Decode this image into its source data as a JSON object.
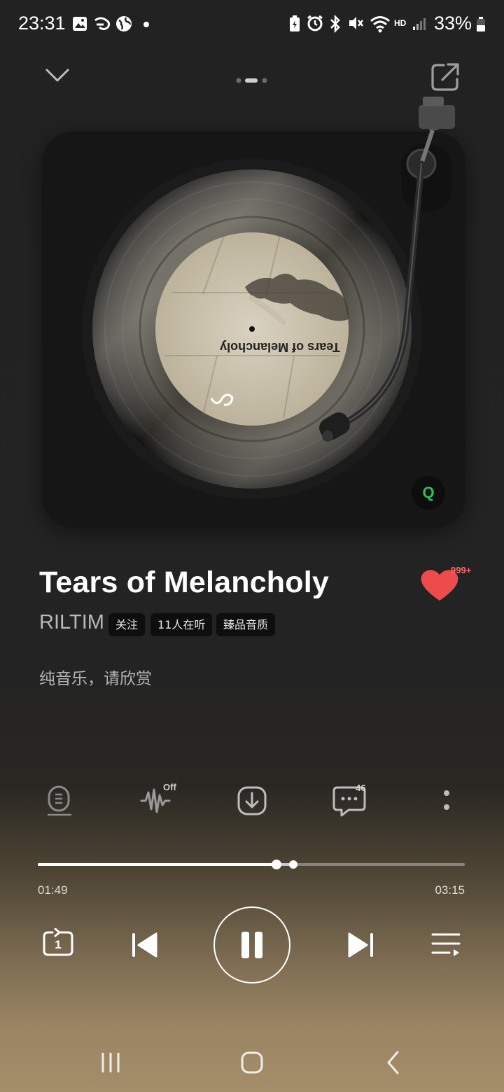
{
  "status_bar": {
    "time": "23:31",
    "battery_percent": "33%",
    "network_label": "HD"
  },
  "header": {
    "page_indicator_count": 3,
    "active_page": 1
  },
  "turntable": {
    "record_label_text": "Tears of Melancholy",
    "badge": "Q"
  },
  "track": {
    "title": "Tears of Melancholy",
    "artist": "RILTIM",
    "tags": [
      "关注",
      "11人在听",
      "臻品音质"
    ],
    "description": "纯音乐，请欣赏",
    "like_count": "999+"
  },
  "actions": {
    "effect_badge": "Off",
    "comment_count": "46"
  },
  "progress": {
    "current": "01:49",
    "total": "03:15",
    "played_fraction": 0.559,
    "buffered_fraction": 0.599
  },
  "controls": {
    "repeat_badge": "1"
  },
  "colors": {
    "accent_heart": "#ee4c4c",
    "badge_green": "#25c45f",
    "background": "#222222"
  }
}
